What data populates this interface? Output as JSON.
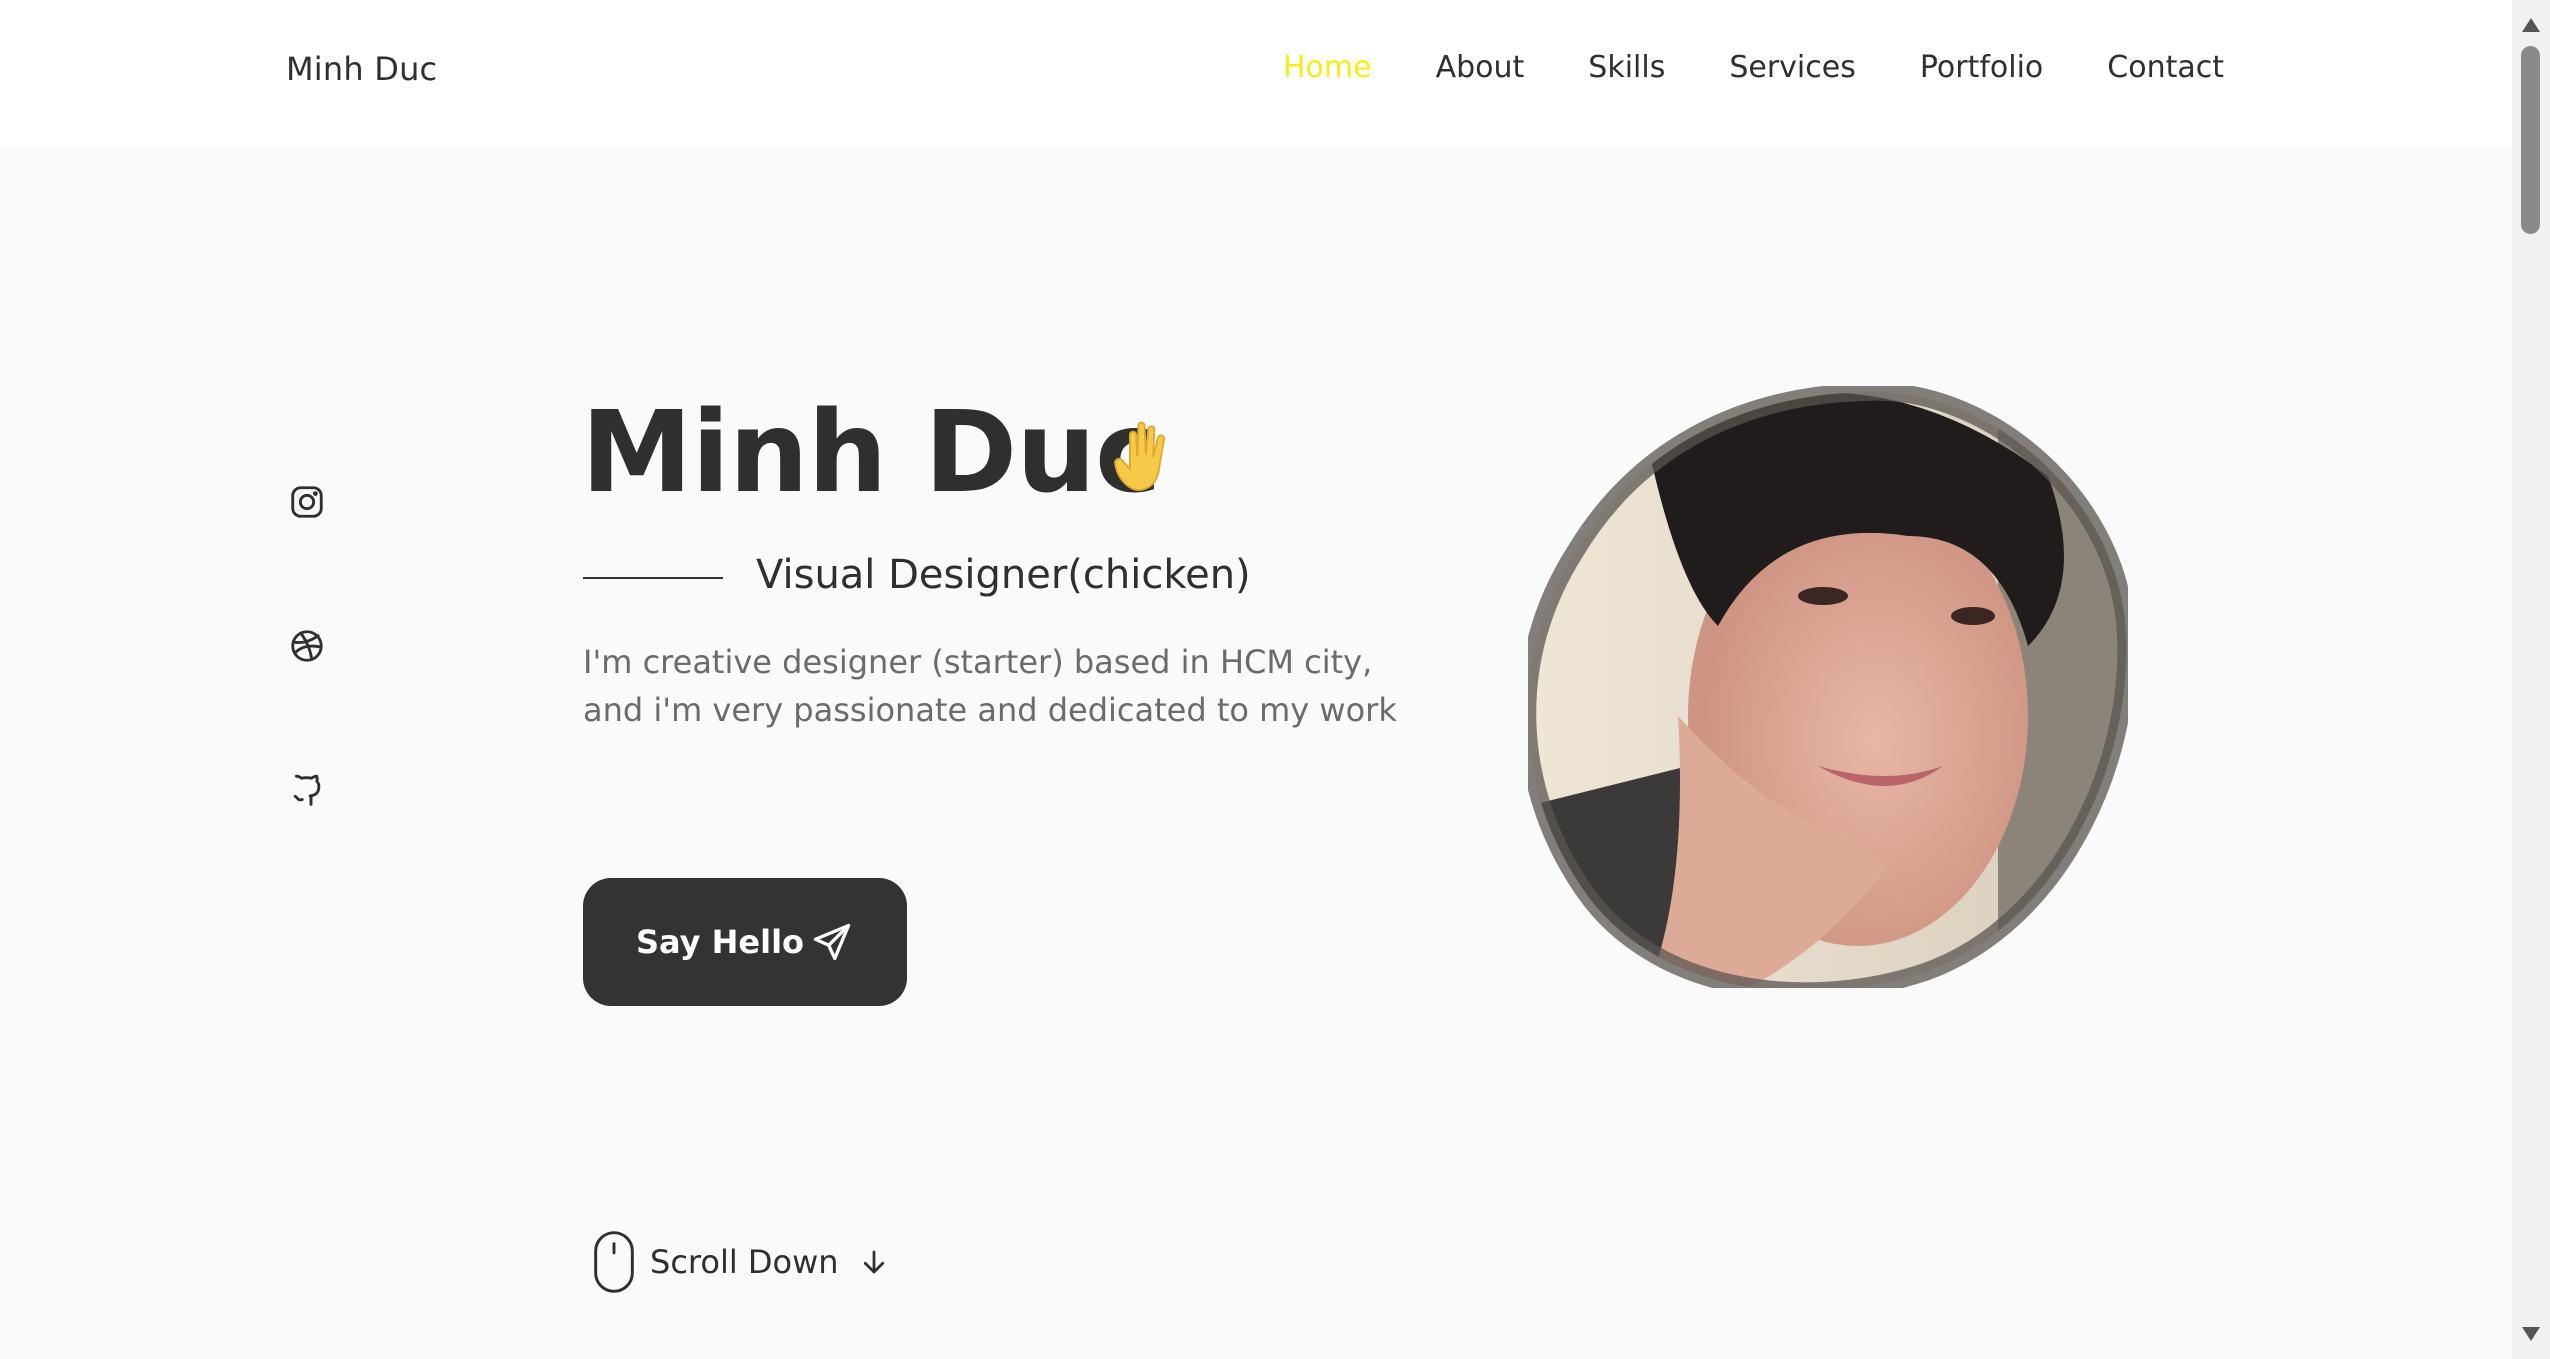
{
  "header": {
    "logo": "Minh Duc",
    "nav": [
      {
        "label": "Home",
        "active": true
      },
      {
        "label": "About",
        "active": false
      },
      {
        "label": "Skills",
        "active": false
      },
      {
        "label": "Services",
        "active": false
      },
      {
        "label": "Portfolio",
        "active": false
      },
      {
        "label": "Contact",
        "active": false
      }
    ]
  },
  "social": [
    {
      "icon": "instagram-icon"
    },
    {
      "icon": "dribbble-icon"
    },
    {
      "icon": "github-icon"
    }
  ],
  "hero": {
    "title": "Minh Duc",
    "title_emoji": "waving-hand-icon",
    "subtitle": "Visual Designer(chicken)",
    "description": "I'm creative designer (starter) based in HCM city, and i'm very passionate and dedicated to my work",
    "cta_label": "Say Hello",
    "cta_icon": "send-icon"
  },
  "scroll": {
    "label": "Scroll Down"
  },
  "colors": {
    "accent": "#f6ef16",
    "text": "#333333",
    "muted": "#6b6b6b",
    "background": "#fafafa",
    "button": "#333333"
  }
}
